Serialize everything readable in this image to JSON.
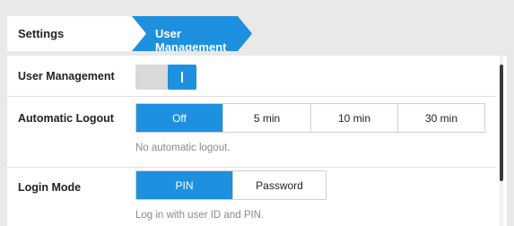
{
  "breadcrumb": {
    "items": [
      "Settings",
      "User Management"
    ]
  },
  "sections": {
    "user_management": {
      "label": "User Management",
      "enabled": true
    },
    "automatic_logout": {
      "label": "Automatic Logout",
      "options": [
        "Off",
        "5 min",
        "10 min",
        "30 min"
      ],
      "selected": "Off",
      "hint": "No automatic logout."
    },
    "login_mode": {
      "label": "Login Mode",
      "options": [
        "PIN",
        "Password"
      ],
      "selected": "PIN",
      "hint": "Log in with user ID and PIN."
    }
  },
  "colors": {
    "accent": "#1e90e0",
    "panel": "#ffffff",
    "background": "#e9e9e9"
  }
}
